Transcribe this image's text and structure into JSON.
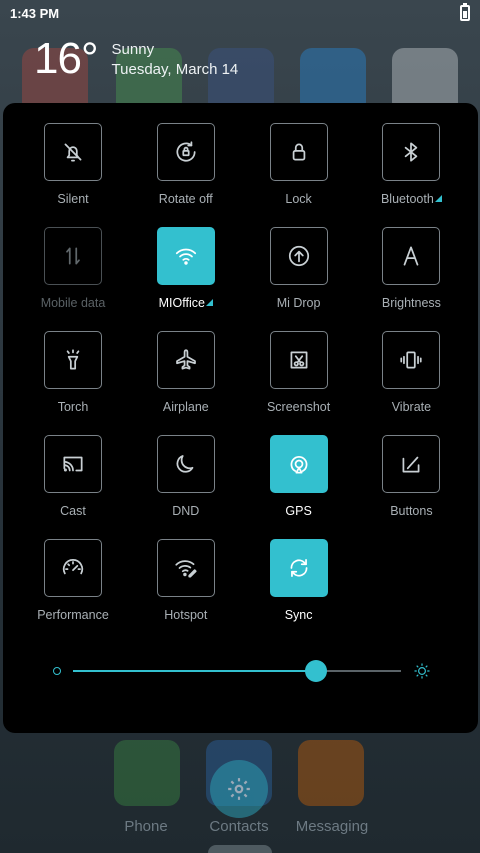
{
  "status_bar": {
    "time": "1:43 PM"
  },
  "weather": {
    "temperature": "16°",
    "condition": "Sunny",
    "date": "Tuesday, March 14"
  },
  "tiles": [
    {
      "label": "Silent",
      "icon": "bell-off-icon",
      "state": "off"
    },
    {
      "label": "Rotate off",
      "icon": "rotate-lock-icon",
      "state": "off"
    },
    {
      "label": "Lock",
      "icon": "lock-icon",
      "state": "off"
    },
    {
      "label": "Bluetooth",
      "icon": "bluetooth-icon",
      "state": "off",
      "expand": true
    },
    {
      "label": "Mobile data",
      "icon": "mobile-data-icon",
      "state": "disabled"
    },
    {
      "label": "MIOffice",
      "icon": "wifi-icon",
      "state": "on",
      "expand": true
    },
    {
      "label": "Mi Drop",
      "icon": "upload-circle-icon",
      "state": "off"
    },
    {
      "label": "Brightness",
      "icon": "letter-a-icon",
      "state": "off"
    },
    {
      "label": "Torch",
      "icon": "torch-icon",
      "state": "off"
    },
    {
      "label": "Airplane",
      "icon": "airplane-icon",
      "state": "off"
    },
    {
      "label": "Screenshot",
      "icon": "scissors-icon",
      "state": "off"
    },
    {
      "label": "Vibrate",
      "icon": "vibrate-icon",
      "state": "off"
    },
    {
      "label": "Cast",
      "icon": "cast-icon",
      "state": "off"
    },
    {
      "label": "DND",
      "icon": "moon-icon",
      "state": "off"
    },
    {
      "label": "GPS",
      "icon": "location-icon",
      "state": "on"
    },
    {
      "label": "Buttons",
      "icon": "buttons-icon",
      "state": "off"
    },
    {
      "label": "Performance",
      "icon": "gauge-icon",
      "state": "off"
    },
    {
      "label": "Hotspot",
      "icon": "hotspot-icon",
      "state": "off"
    },
    {
      "label": "Sync",
      "icon": "sync-icon",
      "state": "on"
    }
  ],
  "brightness": {
    "level": 0.74
  },
  "dock": {
    "labels": [
      "Phone",
      "Contacts",
      "Messaging"
    ]
  },
  "colors": {
    "accent": "#33c0cf",
    "panel": "#000000"
  }
}
